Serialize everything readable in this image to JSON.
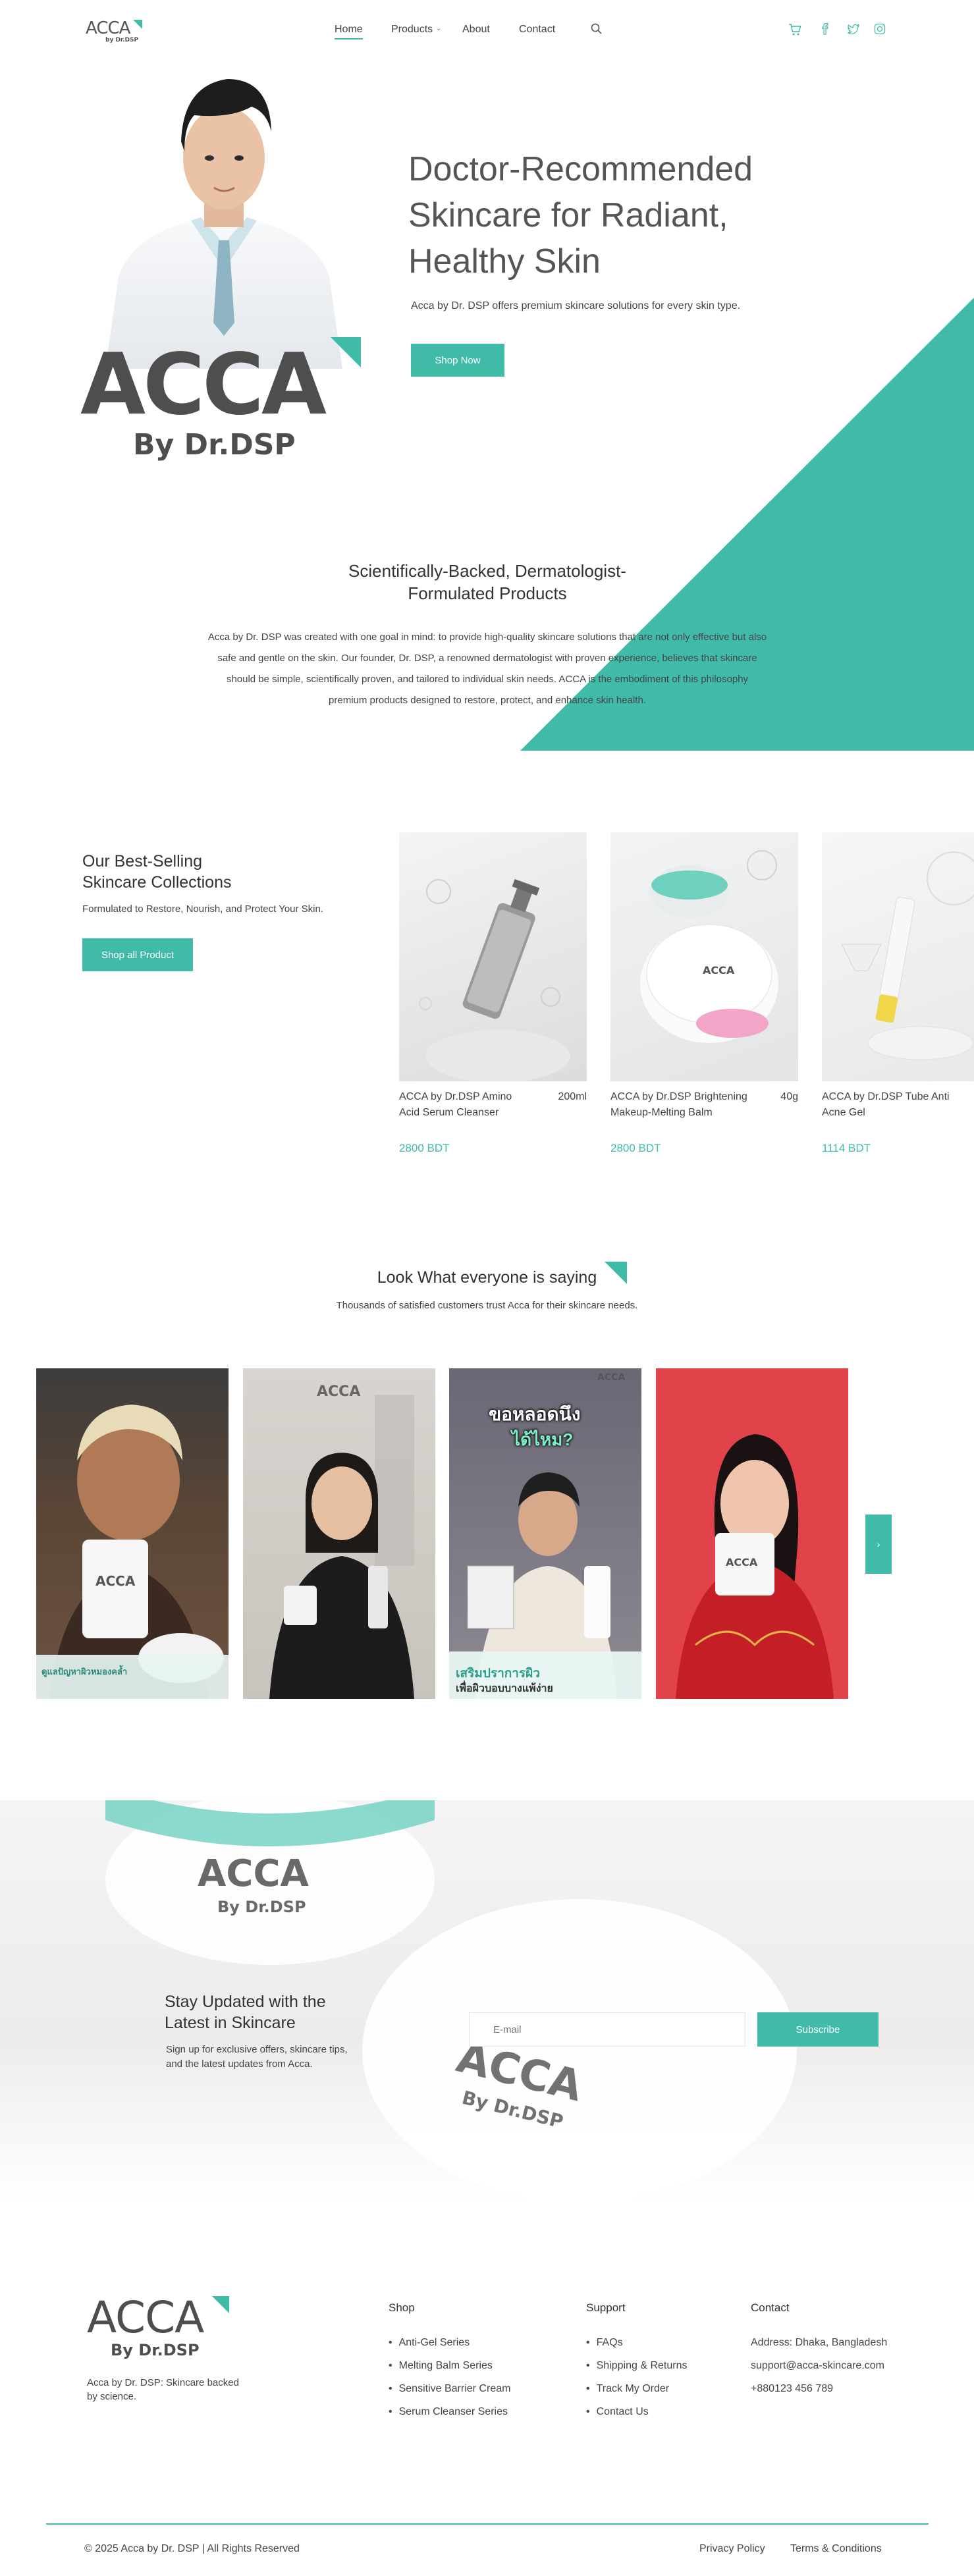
{
  "brand": {
    "name": "ACCA",
    "sub": "by Dr.DSP",
    "sub_big": "By Dr.DSP"
  },
  "nav": {
    "home": "Home",
    "products": "Products",
    "about": "About",
    "contact": "Contact"
  },
  "hero": {
    "title_line1": "Doctor-Recommended",
    "title_line2": "Skincare for Radiant,",
    "title_line3": "Healthy Skin",
    "subtitle": "Acca by Dr. DSP offers premium skincare solutions for every skin type.",
    "cta": "Shop Now"
  },
  "about": {
    "title_line1": "Scientifically-Backed, Dermatologist-",
    "title_line2": "Formulated Products",
    "paragraph_line1": "Acca by Dr. DSP was created with one goal in mind: to provide high-quality skincare solutions that are not only effective but also",
    "paragraph_line2": "safe and gentle on the skin. Our founder, Dr. DSP, a renowned dermatologist with proven experience, believes that skincare",
    "paragraph_line3": "should be simple, scientifically proven, and tailored to individual skin needs. ACCA is the embodiment of this philosophy",
    "paragraph_line4": "premium products designed to restore, protect, and enhance skin health."
  },
  "bestsellers": {
    "title_line1": "Our Best-Selling",
    "title_line2": "Skincare Collections",
    "subtitle": "Formulated to Restore, Nourish, and Protect Your Skin.",
    "cta": "Shop all Product",
    "products": [
      {
        "name_line1": "ACCA by Dr.DSP Amino",
        "name_line2": "Acid Serum Cleanser",
        "size": "200ml",
        "price": "2800 BDT"
      },
      {
        "name_line1": "ACCA by Dr.DSP Brightening",
        "name_line2": "Makeup-Melting Balm",
        "size": "40g",
        "price": "2800 BDT"
      },
      {
        "name_line1": "ACCA by Dr.DSP Tube Anti",
        "name_line2": "Acne Gel",
        "size": "",
        "price": "1114 BDT"
      }
    ]
  },
  "testimonials": {
    "title": "Look What everyone is saying",
    "subtitle": "Thousands of satisfied customers trust Acca for their skincare needs.",
    "thai_1": "ขอหลอดนึง",
    "thai_2": "ได้ไหม?",
    "thai_3": "เสริมปราการผิว",
    "thai_4": "เพื่อผิวบอบบางแพ้ง่าย",
    "thai_5": "ดูแลปัญหาผิวหมองคล้ำ"
  },
  "newsletter": {
    "title_line1": "Stay Updated with the",
    "title_line2": "Latest in Skincare",
    "text_line1": "Sign up for exclusive offers, skincare tips,",
    "text_line2": "and the latest updates from Acca.",
    "placeholder": "E-mail",
    "cta": "Subscribe"
  },
  "footer": {
    "tagline_line1": "Acca by Dr. DSP: Skincare backed",
    "tagline_line2": "by science.",
    "shop": {
      "title": "Shop",
      "items": [
        "Anti-Gel Series",
        "Melting Balm Series",
        "Sensitive Barrier Cream",
        "Serum Cleanser Series"
      ]
    },
    "support": {
      "title": "Support",
      "items": [
        "FAQs",
        "Shipping & Returns",
        "Track My Order",
        "Contact Us"
      ]
    },
    "contact": {
      "title": "Contact",
      "address": "Address: Dhaka, Bangladesh",
      "email": "support@acca-skincare.com",
      "phone": "+880123 456 789"
    },
    "copyright": "© 2025 Acca by Dr. DSP | All Rights Reserved",
    "privacy": "Privacy Policy",
    "terms": "Terms & Conditions"
  },
  "colors": {
    "accent": "#3fbba8",
    "text": "#3a3a3a"
  },
  "icons": [
    "search-icon",
    "cart-icon",
    "facebook-icon",
    "twitter-icon",
    "instagram-icon",
    "chevron-right-icon",
    "chevron-down-icon"
  ]
}
